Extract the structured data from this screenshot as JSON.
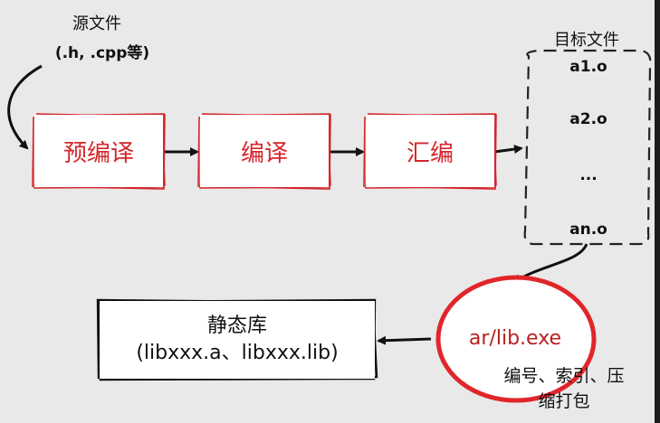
{
  "source": {
    "title": "源文件",
    "subtitle": "(.h, .cpp等)"
  },
  "stages": [
    {
      "label": "预编译"
    },
    {
      "label": "编译"
    },
    {
      "label": "汇编"
    }
  ],
  "objects": {
    "title": "目标文件",
    "items": [
      "a1.o",
      "a2.o",
      "...",
      "an.o"
    ]
  },
  "tool": {
    "label": "ar/lib.exe",
    "note_line1": "编号、索引、压",
    "note_line2": "缩打包"
  },
  "library": {
    "title": "静态库",
    "subtitle": "(libxxx.a、libxxx.lib)"
  },
  "colors": {
    "background": "#e9e9e9",
    "accent_red": "#d4262b",
    "ellipse_red": "#e0262b",
    "ink": "#111111"
  }
}
